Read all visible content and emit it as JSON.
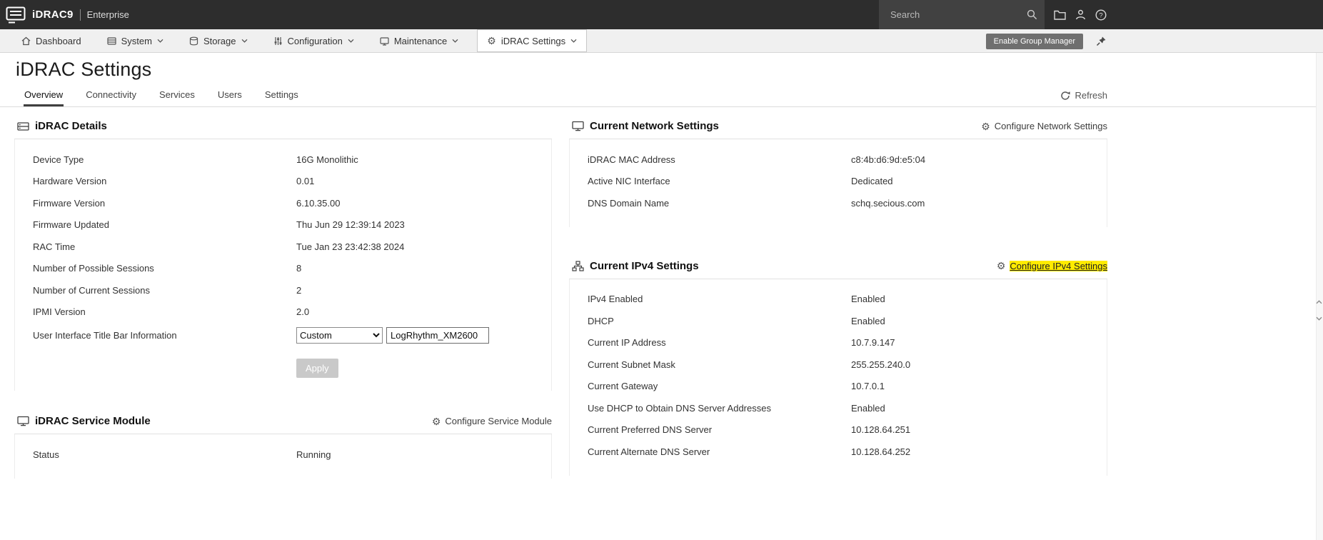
{
  "topbar": {
    "brand": "iDRAC9",
    "edition": "Enterprise",
    "search_placeholder": "Search"
  },
  "nav": {
    "dashboard": "Dashboard",
    "system": "System",
    "storage": "Storage",
    "configuration": "Configuration",
    "maintenance": "Maintenance",
    "idrac_settings": "iDRAC Settings",
    "enable_group_manager": "Enable Group Manager"
  },
  "page": {
    "title": "iDRAC Settings",
    "refresh": "Refresh",
    "tabs": [
      {
        "label": "Overview"
      },
      {
        "label": "Connectivity"
      },
      {
        "label": "Services"
      },
      {
        "label": "Users"
      },
      {
        "label": "Settings"
      }
    ]
  },
  "icons": {
    "gear_glyph": "⚙"
  },
  "colors": {
    "topbar_bg": "#2d2d2d",
    "nav_bg": "#f0f0f0",
    "find_highlight": "#ffeb00"
  },
  "idrac_details": {
    "title": "iDRAC Details",
    "rows": [
      {
        "label": "Device Type",
        "value": "16G Monolithic"
      },
      {
        "label": "Hardware Version",
        "value": "0.01"
      },
      {
        "label": "Firmware Version",
        "value": "6.10.35.00"
      },
      {
        "label": "Firmware Updated",
        "value": "Thu Jun 29 12:39:14 2023"
      },
      {
        "label": "RAC Time",
        "value": "Tue Jan 23 23:42:38 2024"
      },
      {
        "label": "Number of Possible Sessions",
        "value": "8"
      },
      {
        "label": "Number of Current Sessions",
        "value": "2"
      },
      {
        "label": "IPMI Version",
        "value": "2.0"
      }
    ],
    "title_bar": {
      "label": "User Interface Title Bar Information",
      "select_value": "Custom",
      "input_value": "LogRhythm_XM2600"
    },
    "apply": "Apply"
  },
  "service_module": {
    "title": "iDRAC Service Module",
    "action": "Configure Service Module",
    "rows": [
      {
        "label": "Status",
        "value": "Running"
      }
    ]
  },
  "network_settings": {
    "title": "Current Network Settings",
    "action": "Configure Network Settings",
    "rows": [
      {
        "label": "iDRAC MAC Address",
        "value": "c8:4b:d6:9d:e5:04"
      },
      {
        "label": "Active NIC Interface",
        "value": "Dedicated"
      },
      {
        "label": "DNS Domain Name",
        "value": "schq.secious.com"
      }
    ]
  },
  "ipv4_settings": {
    "title": "Current IPv4 Settings",
    "action": "Configure IPv4 Settings",
    "rows": [
      {
        "label": "IPv4 Enabled",
        "value": "Enabled"
      },
      {
        "label": "DHCP",
        "value": "Enabled"
      },
      {
        "label": "Current IP Address",
        "value": "10.7.9.147"
      },
      {
        "label": "Current Subnet Mask",
        "value": "255.255.240.0"
      },
      {
        "label": "Current Gateway",
        "value": "10.7.0.1"
      },
      {
        "label": "Use DHCP to Obtain DNS Server Addresses",
        "value": "Enabled"
      },
      {
        "label": "Current Preferred DNS Server",
        "value": "10.128.64.251"
      },
      {
        "label": "Current Alternate DNS Server",
        "value": "10.128.64.252"
      }
    ]
  }
}
